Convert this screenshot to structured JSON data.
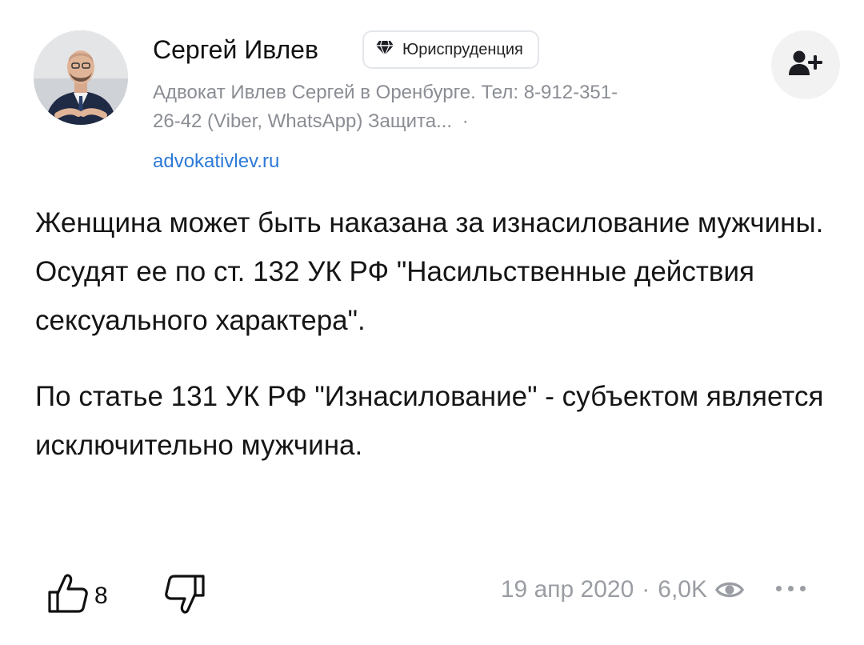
{
  "author": {
    "name": "Сергей Ивлев",
    "badge_label": "Юриспруденция",
    "bio": "Адвокат Ивлев Сергей в Оренбурге. Тел: 8-912-351-26-42 (Viber, WhatsApp) Защита...",
    "bio_separator": "·",
    "site": "advokativlev.ru",
    "avatar_icon": "avatar-photo",
    "subscribe_icon": "add-user-icon"
  },
  "post": {
    "paragraphs": [
      "Женщина может быть наказана за изнасилование мужчины. Осудят ее по ст. 132 УК РФ \"Насильственные действия сексуального характера\".",
      "По статье 131 УК РФ \"Изнасилование\" - субъектом является исключительно мужчина."
    ]
  },
  "footer": {
    "like_count": "8",
    "date": "19 апр 2020",
    "separator": "·",
    "views": "6,0K",
    "like_icon": "thumbs-up-icon",
    "dislike_icon": "thumbs-down-icon",
    "views_icon": "eye-icon",
    "more_icon": "more-dots-icon"
  },
  "colors": {
    "link": "#2c7ad8",
    "muted": "#8a8d93",
    "badge_border": "#e3e6ea",
    "button_bg": "#f2f2f2"
  }
}
